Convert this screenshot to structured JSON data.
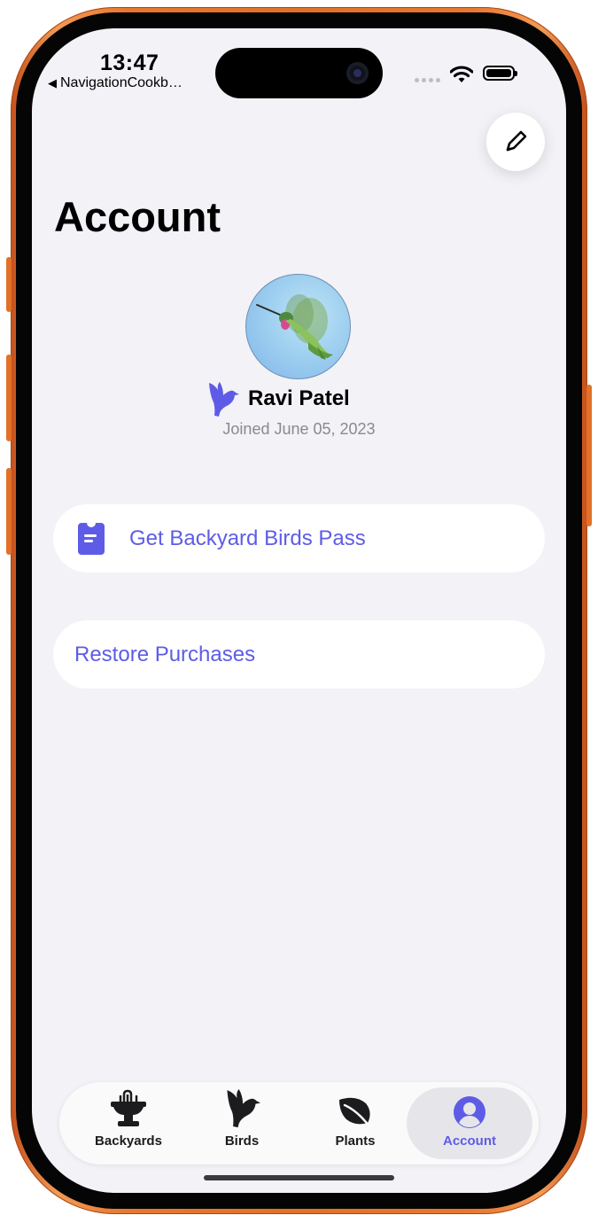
{
  "status_bar": {
    "time": "13:47",
    "back_label": "NavigationCookb…",
    "back_icon": "back-triangle-icon"
  },
  "header": {
    "title": "Account",
    "edit_icon": "pencil-icon"
  },
  "profile": {
    "name": "Ravi Patel",
    "joined": "Joined June 05, 2023",
    "avatar": "hummingbird-avatar",
    "badge_icon": "bird-icon"
  },
  "actions": {
    "pass_label": "Get Backyard Birds Pass",
    "pass_icon": "pass-card-icon",
    "restore_label": "Restore Purchases"
  },
  "tabs": [
    {
      "label": "Backyards",
      "icon": "fountain-icon",
      "active": false
    },
    {
      "label": "Birds",
      "icon": "bird-icon",
      "active": false
    },
    {
      "label": "Plants",
      "icon": "leaf-icon",
      "active": false
    },
    {
      "label": "Account",
      "icon": "person-circle-icon",
      "active": true
    }
  ],
  "colors": {
    "accent": "#5e5ce6",
    "background": "#f2f2f7",
    "frame": "#e27127"
  }
}
